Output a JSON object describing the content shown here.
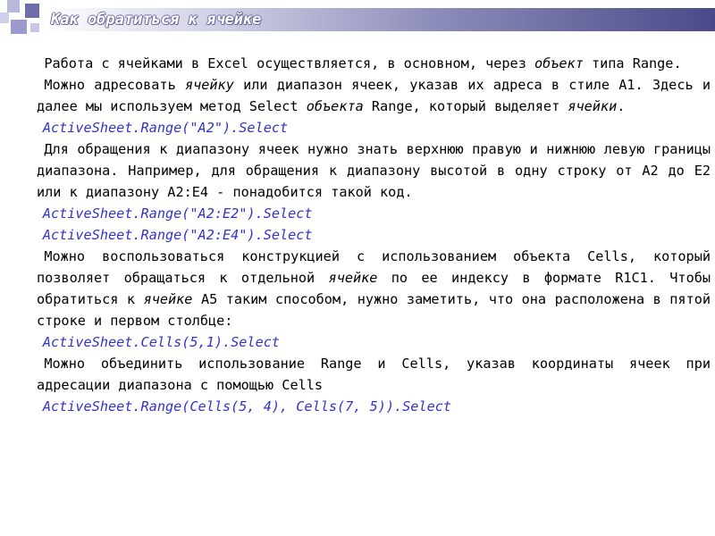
{
  "title": "Как обратиться к ячейке",
  "colors": {
    "accent": "#3333cc",
    "title_bar_dark": "#4a4a8a",
    "squares": "#9999cc"
  },
  "paragraphs": {
    "p1": {
      "t1": "Работа с ячейками в Excel осуществляется, в основном, через ",
      "e1": "объект",
      "t2": " типа Range."
    },
    "p2": {
      "t1": "Можно адресовать ",
      "e1": "ячейку",
      "t2": " или диапазон ячеек, указав их адреса в стиле А1. Здесь и далее мы используем метод Select ",
      "e2": "объекта",
      "t3": " Range, который выделяет ",
      "e3": "ячейки",
      "t4": "."
    },
    "p3": {
      "t1": "Для обращения к диапазону ячеек нужно знать верхнюю правую и нижнюю левую границы диапазона. Например, для обращения к диапазону высотой в одну строку от A2 до E2 или к диапазону A2:E4 - понадобится такой код."
    },
    "p4": {
      "t1": "Можно воспользоваться конструкцией с использованием объекта Cells, который позволяет обращаться к отдельной ",
      "e1": "ячейке",
      "t2": " по ее индексу в формате R1C1. Чтобы обратиться к ",
      "e2": "ячейке",
      "t3": " A5 таким способом, нужно заметить, что она расположена в пятой строке и первом столбце:"
    },
    "p5": {
      "t1": "Можно объединить использование Range и Cells, указав координаты ячеек при адресации диапазона с помощью Cells"
    }
  },
  "code": {
    "c1": "ActiveSheet.Range(\"A2\").Select",
    "c2": "ActiveSheet.Range(\"A2:E2\").Select",
    "c3": "ActiveSheet.Range(\"A2:E4\").Select",
    "c4": "ActiveSheet.Cells(5,1).Select",
    "c5": "ActiveSheet.Range(Cells(5, 4), Cells(7, 5)).Select"
  }
}
